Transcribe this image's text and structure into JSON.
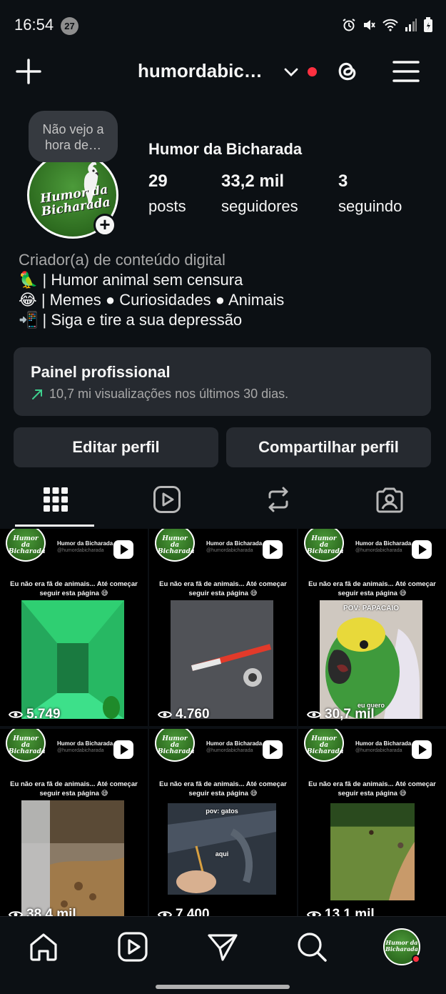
{
  "status_bar": {
    "time": "16:54",
    "notification_count": "27",
    "icons": [
      "alarm-icon",
      "mute-icon",
      "wifi-icon",
      "signal-icon",
      "battery-icon"
    ]
  },
  "header": {
    "username": "humordabic…",
    "has_notification_dot": true,
    "icons": [
      "plus-icon",
      "chevron-down-icon",
      "threads-icon",
      "menu-icon"
    ]
  },
  "profile": {
    "note": "Não vejo a hora de…",
    "avatar_text": "Humor da Bicharada",
    "display_name": "Humor da Bicharada",
    "stats": [
      {
        "value": "29",
        "label": "posts"
      },
      {
        "value": "33,2 mil",
        "label": "seguidores"
      },
      {
        "value": "3",
        "label": "seguindo"
      }
    ],
    "category": "Criador(a) de conteúdo digital",
    "bio_lines": [
      "🦜 | Humor animal sem censura",
      "😂 | Memes ● Curiosidades ● Animais",
      "📲 | Siga e tire a sua depressão"
    ]
  },
  "pro_dashboard": {
    "title": "Painel profissional",
    "subtitle": "10,7 mi visualizações nos últimos 30 dias."
  },
  "actions": {
    "edit": "Editar perfil",
    "share": "Compartilhar perfil"
  },
  "tabs": [
    "grid-icon",
    "reels-icon",
    "reposts-icon",
    "tagged-icon"
  ],
  "posts": [
    {
      "brand": "Humor da Bicharada",
      "handle": "@humordabicharada",
      "caption": "Eu não era fã de animais... Até começar seguir esta página 😅",
      "overlay_top": "",
      "overlay_bottom": "",
      "views": "5.749"
    },
    {
      "brand": "Humor da Bicharada",
      "handle": "@humordabicharada",
      "caption": "Eu não era fã de animais... Até começar seguir esta página 😅",
      "overlay_top": "",
      "overlay_bottom": "",
      "views": "4.760"
    },
    {
      "brand": "Humor da Bicharada",
      "handle": "@humordabicharada",
      "caption": "Eu não era fã de animais... Até começar seguir esta página 😅",
      "overlay_top": "POV: PAPACAIO",
      "overlay_bottom": "eu quero",
      "views": "30,7 mil"
    },
    {
      "brand": "Humor da Bicharada",
      "handle": "@humordabicharada",
      "caption": "Eu não era fã de animais... Até começar seguir esta página 😅",
      "overlay_top": "",
      "overlay_bottom": "",
      "views": "38,4 mil"
    },
    {
      "brand": "Humor da Bicharada",
      "handle": "@humordabicharada",
      "caption": "Eu não era fã de animais... Até começar seguir esta página 😅",
      "overlay_top": "pov: gatos",
      "overlay_bottom": "aqui",
      "views": "7.400"
    },
    {
      "brand": "Humor da Bicharada",
      "handle": "@humordabicharada",
      "caption": "Eu não era fã de animais... Até começar seguir esta página 😅",
      "overlay_top": "",
      "overlay_bottom": "",
      "views": "13,1 mil"
    }
  ],
  "bottom_nav": [
    "home-icon",
    "reels-icon",
    "send-icon",
    "search-icon",
    "profile-avatar"
  ],
  "colors": {
    "background": "#0c1014",
    "card": "#262a30",
    "accent_red": "#ff3040",
    "trend_green": "#3ecf8e"
  }
}
